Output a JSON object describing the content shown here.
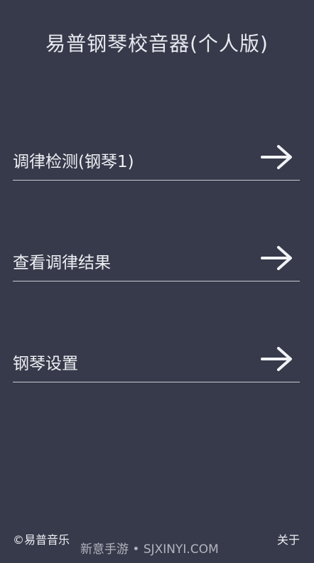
{
  "header": {
    "title": "易普钢琴校音器(个人版)"
  },
  "menu": {
    "items": [
      {
        "label": "调律检测(钢琴1)",
        "icon": "arrow-right-icon"
      },
      {
        "label": "查看调律结果",
        "icon": "arrow-right-icon"
      },
      {
        "label": "钢琴设置",
        "icon": "arrow-right-icon"
      }
    ]
  },
  "footer": {
    "copyright": "©易普音乐",
    "about_label": "关于"
  },
  "watermark": {
    "text": "新意手游 • SJXINYI.COM"
  },
  "colors": {
    "background": "#363a4a",
    "text": "#eef0f4",
    "divider": "#c9ccd4"
  }
}
